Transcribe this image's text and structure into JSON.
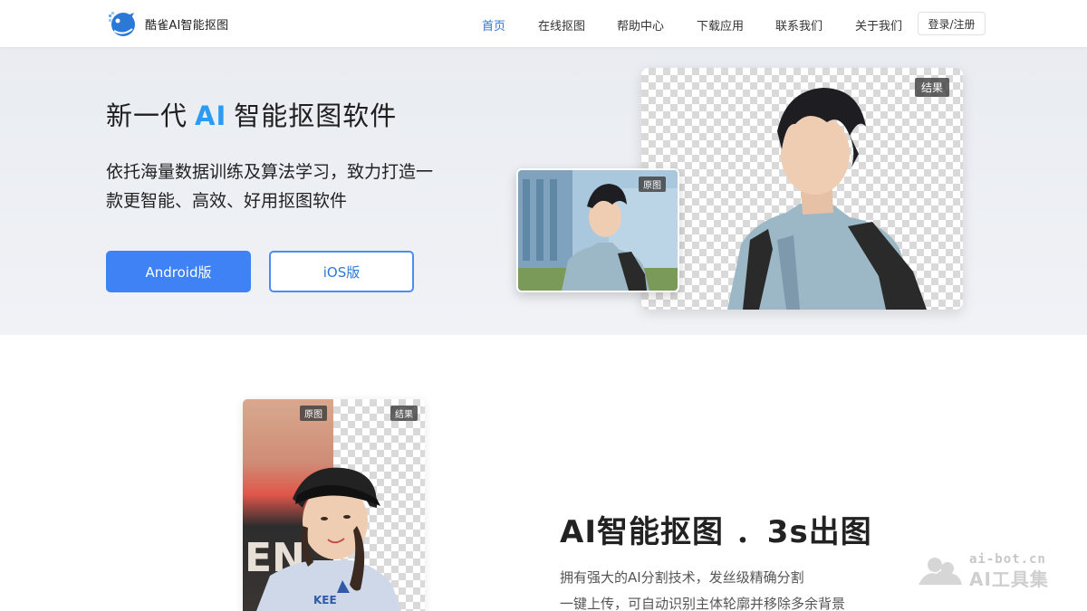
{
  "header": {
    "brand": "酷雀AI智能抠图",
    "nav": [
      "首页",
      "在线抠图",
      "帮助中心",
      "下载应用",
      "联系我们",
      "关于我们"
    ],
    "active_nav": "首页",
    "login": "登录/注册"
  },
  "hero": {
    "title_prefix": "新一代",
    "title_ai": "AI",
    "title_suffix": "智能抠图软件",
    "desc_line1": "依托海量数据训练及算法学习，致力打造一",
    "desc_line2": "款更智能、高效、好用抠图软件",
    "android_label": "Android版",
    "ios_label": "iOS版",
    "result_tag": "结果",
    "original_tag": "原图"
  },
  "feature": {
    "original_tag": "原图",
    "result_tag": "结果",
    "title": "AI智能抠图 ．3s出图",
    "line1": "拥有强大的AI分割技术，发丝级精确分割",
    "line2": "一键上传，可自动识别主体轮廓并移除多余背景",
    "shirt_text": "KEE"
  },
  "watermark": {
    "url": "ai-bot.cn",
    "name": "AI工具集"
  },
  "colors": {
    "accent": "#2b78d6",
    "ai_blue": "#2b9bf4",
    "primary_button": "#3f82f6"
  }
}
